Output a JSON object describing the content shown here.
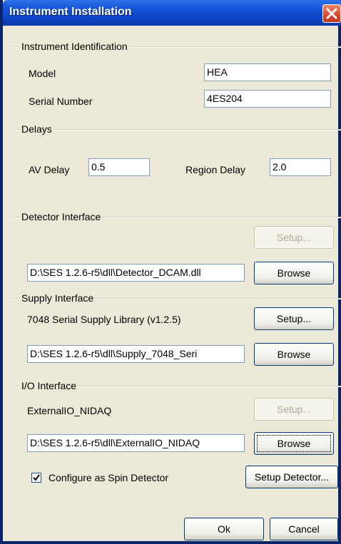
{
  "window": {
    "title": "Instrument Installation"
  },
  "identification": {
    "legend": "Instrument Identification",
    "model_label": "Model",
    "model_value": "HEA",
    "serial_label": "Serial Number",
    "serial_value": "4ES204"
  },
  "delays": {
    "legend": "Delays",
    "av_label": "AV Delay",
    "av_value": "0.5",
    "region_label": "Region Delay",
    "region_value": "2.0"
  },
  "detector": {
    "legend": "Detector Interface",
    "setup_label": "Setup...",
    "path": "D:\\SES 1.2.6-r5\\dll\\Detector_DCAM.dll",
    "browse_label": "Browse"
  },
  "supply": {
    "legend": "Supply Interface",
    "library": "7048 Serial Supply Library (v1.2.5)",
    "setup_label": "Setup...",
    "path": "D:\\SES 1.2.6-r5\\dll\\Supply_7048_Seri",
    "browse_label": "Browse"
  },
  "io": {
    "legend": "I/O Interface",
    "library": "ExternalIO_NIDAQ",
    "setup_label": "Setup...",
    "path": "D:\\SES 1.2.6-r5\\dll\\ExternalIO_NIDAQ",
    "browse_label": "Browse",
    "spin_label": "Configure as Spin Detector",
    "spin_checked": true,
    "setup_detector_label": "Setup Detector..."
  },
  "footer": {
    "ok_label": "Ok",
    "cancel_label": "Cancel"
  }
}
